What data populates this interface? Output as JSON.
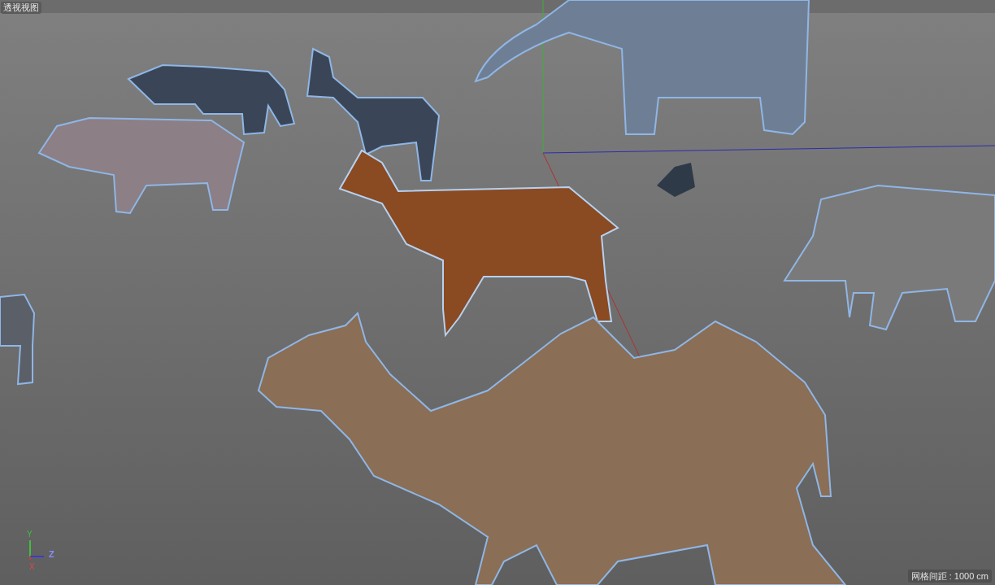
{
  "viewport": {
    "title": "透视视图",
    "grid_spacing": "网格间距 : 1000 cm"
  },
  "axis_gizmo": {
    "y_label": "Y",
    "z_label": "Z",
    "x_label": "X"
  }
}
